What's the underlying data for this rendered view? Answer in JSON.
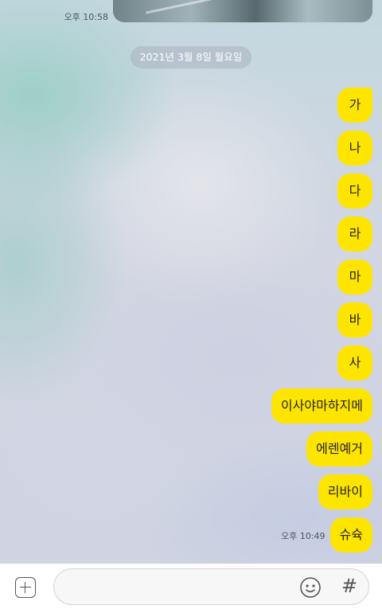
{
  "previous_message": {
    "time": "오후 10:58"
  },
  "date_divider": "2021년 3월 8일 월요일",
  "messages": [
    {
      "text": "가"
    },
    {
      "text": "나"
    },
    {
      "text": "다"
    },
    {
      "text": "라"
    },
    {
      "text": "마"
    },
    {
      "text": "바"
    },
    {
      "text": "사"
    },
    {
      "text": "이사야마하지메"
    },
    {
      "text": "에렌예거"
    },
    {
      "text": "리바이"
    },
    {
      "text": "슈슉"
    }
  ],
  "last_message_time": "오후 10:49",
  "input_bar": {
    "value": "",
    "plus_icon": "plus-square-icon",
    "emoji_icon": "smiley-icon",
    "hash_icon": "#"
  },
  "colors": {
    "bubble": "#fee500",
    "date_pill": "rgba(170,178,192,0.55)"
  }
}
